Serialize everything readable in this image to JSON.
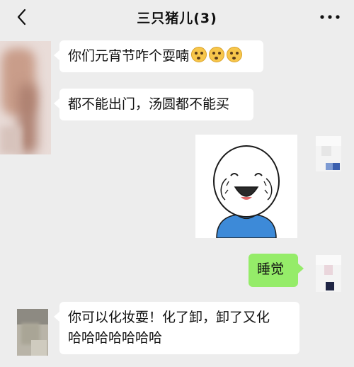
{
  "header": {
    "title": "三只猪儿(3)",
    "back_icon": "chevron-left-icon",
    "more_icon": "more-dots-icon"
  },
  "messages": [
    {
      "side": "left",
      "text": "你们元宵节咋个耍喃",
      "emojis": [
        "pleading-face-emoji",
        "pleading-face-emoji",
        "pleading-face-emoji"
      ]
    },
    {
      "side": "left",
      "text": "都不能出门，汤圆都不能买"
    },
    {
      "side": "right",
      "type": "sticker",
      "sticker": "crying-laughing-stick-figure"
    },
    {
      "side": "right",
      "text": "睡觉"
    },
    {
      "side": "left",
      "lines": [
        "你可以化妆耍！化了卸，卸了又化",
        "哈哈哈哈哈哈哈"
      ]
    }
  ],
  "colors": {
    "background": "#ededed",
    "bubble_other": "#ffffff",
    "bubble_self": "#95ec69",
    "sticker_shirt": "#3d8ad8"
  }
}
